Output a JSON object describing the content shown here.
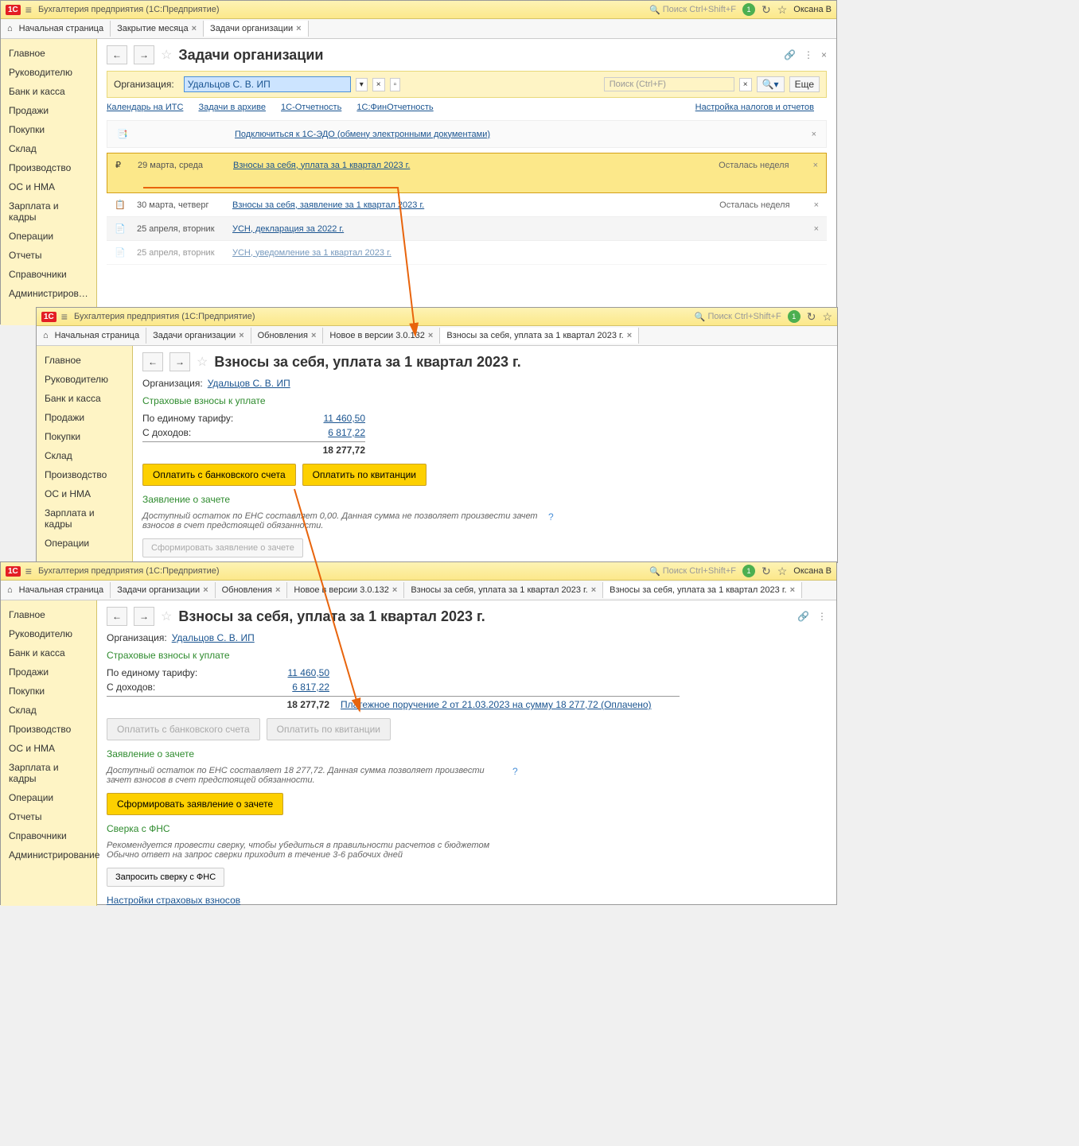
{
  "app": {
    "title": "Бухгалтерия предприятия  (1С:Предприятие)",
    "search_placeholder": "Поиск Ctrl+Shift+F",
    "user": "Оксана В",
    "more": "Еще"
  },
  "shared": {
    "sidebar": [
      "Главное",
      "Руководителю",
      "Банк и касса",
      "Продажи",
      "Покупки",
      "Склад",
      "Производство",
      "ОС и НМА",
      "Зарплата и кадры",
      "Операции",
      "Отчеты",
      "Справочники",
      "Администрирование"
    ],
    "org_label": "Организация:",
    "org_value": "Удальцов С. В. ИП"
  },
  "win1": {
    "tabs": [
      "Начальная страница",
      "Закрытие месяца",
      "Задачи организации"
    ],
    "page_title": "Задачи организации",
    "search_hint": "Поиск (Ctrl+F)",
    "links": {
      "cal": "Календарь на ИТС",
      "arch": "Задачи в архиве",
      "rep": "1С-Отчетность",
      "fin": "1С:ФинОтчетность",
      "right": "Настройка налогов и отчетов"
    },
    "edo": "Подключиться к 1С-ЭДО (обмену электронными документами)",
    "tasks": [
      {
        "icon": "🟡",
        "date": "29 марта, среда",
        "link": "Взносы за себя, уплата за 1 квартал 2023 г.",
        "status": "Осталась неделя"
      },
      {
        "icon": "🟧",
        "date": "30 марта, четверг",
        "link": "Взносы за себя, заявление за 1 квартал 2023 г.",
        "status": "Осталась неделя"
      },
      {
        "icon": "📄",
        "date": "25 апреля, вторник",
        "link": "УСН, декларация за 2022 г.",
        "status": ""
      },
      {
        "icon": "📄",
        "date": "25 апреля, вторник",
        "link": "УСН, уведомление за 1 квартал 2023 г.",
        "status": ""
      }
    ]
  },
  "win2": {
    "tabs": [
      "Начальная страница",
      "Задачи организации",
      "Обновления",
      "Новое в версии 3.0.132",
      "Взносы за себя, уплата за 1 квартал 2023 г."
    ],
    "page_title": "Взносы за себя, уплата за 1 квартал 2023 г.",
    "sec1": "Страховые взносы к уплате",
    "row1": {
      "label": "По единому тарифу:",
      "val": "11 460,50"
    },
    "row2": {
      "label": "С доходов:",
      "val": "6 817,22"
    },
    "total": "18 277,72",
    "btn1": "Оплатить с банковского счета",
    "btn2": "Оплатить по квитанции",
    "sec2": "Заявление о зачете",
    "note": "Доступный остаток по ЕНС составляет 0,00. Данная сумма не позволяет произвести зачет взносов в счет предстоящей обязанности.",
    "btn3": "Сформировать заявление о зачете"
  },
  "win3": {
    "tabs": [
      "Начальная страница",
      "Задачи организации",
      "Обновления",
      "Новое в версии 3.0.132",
      "Взносы за себя, уплата за 1 квартал 2023 г.",
      "Взносы за себя, уплата за 1 квартал 2023 г."
    ],
    "page_title": "Взносы за себя, уплата за 1 квартал 2023 г.",
    "sec1": "Страховые взносы к уплате",
    "row1": {
      "label": "По единому тарифу:",
      "val": "11 460,50"
    },
    "row2": {
      "label": "С доходов:",
      "val": "6 817,22"
    },
    "total": "18 277,72",
    "paid_link": "Платежное поручение 2 от 21.03.2023 на сумму 18 277,72 (Оплачено)",
    "btn1": "Оплатить с банковского счета",
    "btn2": "Оплатить по квитанции",
    "sec2": "Заявление о зачете",
    "note2": "Доступный остаток по ЕНС составляет 18 277,72. Данная сумма позволяет произвести зачет взносов в счет предстоящей обязанности.",
    "btn3": "Сформировать заявление о зачете",
    "sec3": "Сверка с ФНС",
    "note3": "Рекомендуется провести сверку, чтобы убедиться в правильности расчетов с бюджетом\nОбычно ответ на запрос сверки приходит в течение 3-6 рабочих дней",
    "btn4": "Запросить сверку с ФНС",
    "settings_link": "Настройки страховых взносов"
  }
}
